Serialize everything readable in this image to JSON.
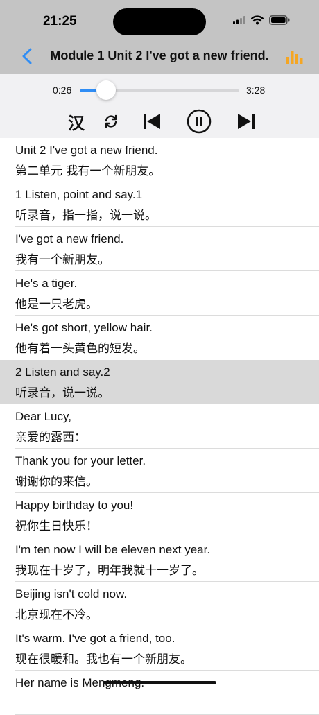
{
  "status_bar": {
    "time": "21:25"
  },
  "nav": {
    "title": "Module 1  Unit 2 I've got a new friend."
  },
  "player": {
    "current_time": "0:26",
    "total_time": "3:28",
    "progress": 0.167,
    "translate_label": "汉",
    "accent_color": "#2f8df5"
  },
  "sentences": [
    {
      "en": "Unit 2 I've got a new friend.",
      "zh": "第二单元 我有一个新朋友。",
      "selected": false
    },
    {
      "en": "1 Listen, point and say.1",
      "zh": "听录音，指一指，说一说。",
      "selected": false
    },
    {
      "en": "I've got a new friend.",
      "zh": "我有一个新朋友。",
      "selected": false
    },
    {
      "en": "He's a tiger.",
      "zh": "他是一只老虎。",
      "selected": false
    },
    {
      "en": "He's got short, yellow hair.",
      "zh": "他有着一头黄色的短发。",
      "selected": false
    },
    {
      "en": "2 Listen and say.2",
      "zh": "听录音，说一说。",
      "selected": true
    },
    {
      "en": "Dear Lucy,",
      "zh": "亲爱的露西：",
      "selected": false
    },
    {
      "en": "Thank you for your letter.",
      "zh": "谢谢你的来信。",
      "selected": false
    },
    {
      "en": "Happy birthday to you!",
      "zh": "祝你生日快乐！",
      "selected": false
    },
    {
      "en": "I'm ten now I will be eleven next year.",
      "zh": "我现在十岁了，明年我就十一岁了。",
      "selected": false
    },
    {
      "en": "Beijing isn't cold now.",
      "zh": "北京现在不冷。",
      "selected": false
    },
    {
      "en": "It's warm. I've got a friend, too.",
      "zh": "现在很暖和。我也有一个新朋友。",
      "selected": false
    },
    {
      "en": "Her name is Mengmeng.",
      "zh": "",
      "selected": false
    }
  ]
}
